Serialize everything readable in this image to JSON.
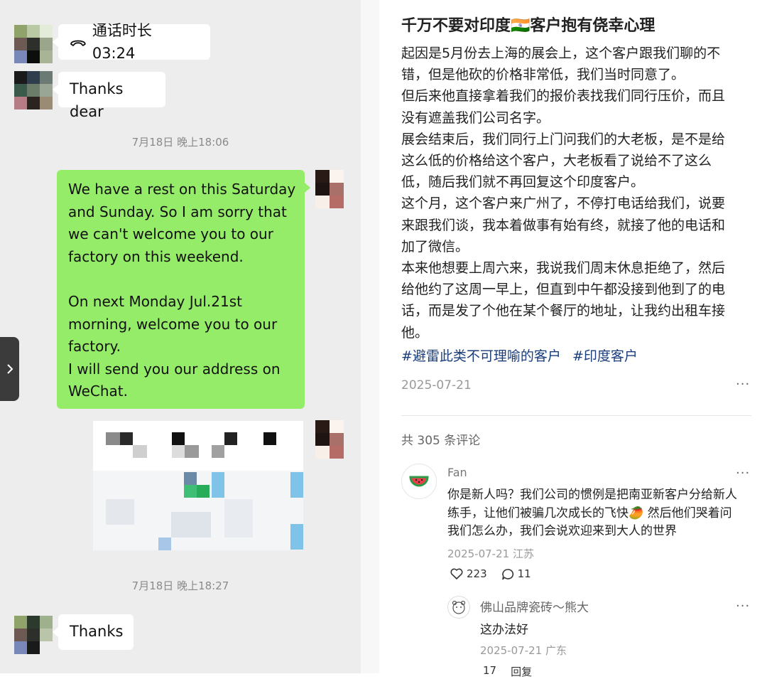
{
  "chat": {
    "call": {
      "label": "通话时长 03:24"
    },
    "msg_thanks_dear": "Thanks dear",
    "timestamp_1": "7月18日 晚上18:06",
    "outgoing_lines_a": [
      "We have a rest on this Saturday",
      "and Sunday. So I am sorry that",
      "we can't welcome you to our",
      "factory on this weekend."
    ],
    "outgoing_lines_b": [
      "On next Monday Jul.21st",
      "morning, welcome you to our",
      "factory.",
      "I will send you our address on",
      "WeChat."
    ],
    "timestamp_2": "7月18日 晚上18:27",
    "msg_thanks": "Thanks",
    "side_tab_icon": "chevron-right-icon"
  },
  "post": {
    "title": "千万不要对印度🇮🇳客户抱有侥幸心理",
    "body_lines": [
      "起因是5月份去上海的展会上，这个客户跟我们聊的不",
      "错，但是他砍的价格非常低，我们当时同意了。",
      "但后来他直接拿着我们的报价表找我们同行压价，而且",
      "没有遮盖我们公司名字。",
      "展会结束后，我们同行上门问我们的大老板，是不是给",
      "这么低的价格给这个客户，大老板看了说给不了这么",
      "低，随后我们就不再回复这个印度客户。",
      "这个月，这个客户来广州了，不停打电话给我们，说要",
      "来跟我们谈，我本着做事有始有终，就接了他的电话和",
      "加了微信。",
      "本来他想要上周六来，我说我们周末休息拒绝了，然后",
      "给他约了这周一早上，但直到中午都没接到他到了的电",
      "话，而是发了个他在某个餐厅的地址，让我约出租车接",
      "他。"
    ],
    "tags": [
      "#避雷此类不可理喻的客户",
      "#印度客户"
    ],
    "date": "2025-07-21",
    "more": "···",
    "comment_count": "共 305 条评论",
    "comments": [
      {
        "user": "Fan",
        "avatar_icon": "watermelon-icon",
        "text_lines": [
          "你是新人吗？我们公司的惯例是把南亚新客户分给新人",
          "练手，让他们被骗几次成长的飞快🥭 然后他们哭着问",
          "我们怎么办，我们会说欢迎来到大人的世界"
        ],
        "meta": "2025-07-21 江苏",
        "likes": "223",
        "replies": "11",
        "reply": {
          "user": "佛山品牌瓷砖～熊大",
          "text": "这办法好",
          "meta": "2025-07-21 广东",
          "likes": "17",
          "reply_label": "回复"
        }
      }
    ]
  },
  "colors": {
    "chat_bg": "#ededed",
    "bubble_green": "#95ec69",
    "bubble_white": "#ffffff",
    "tag_blue": "#1a3d7c"
  }
}
